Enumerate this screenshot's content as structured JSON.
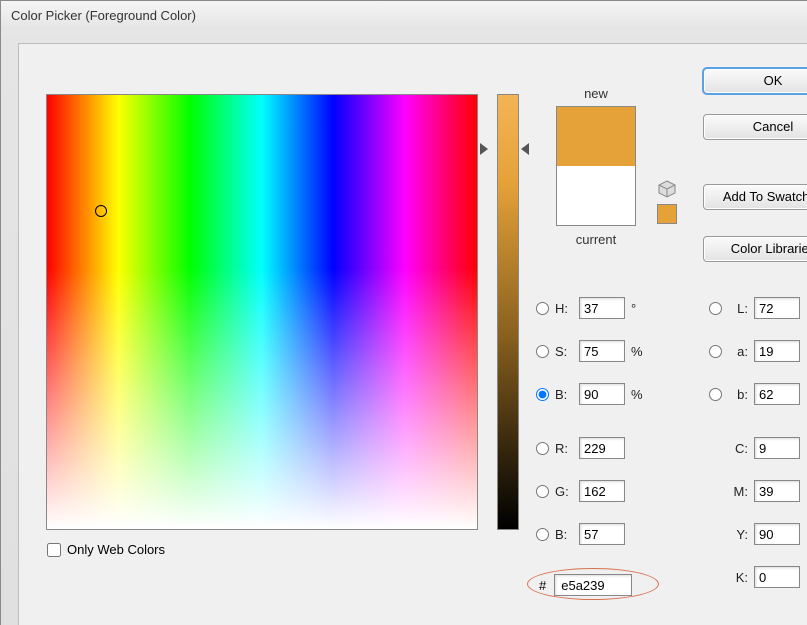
{
  "window": {
    "title": "Color Picker (Foreground Color)"
  },
  "buttons": {
    "ok": "OK",
    "cancel": "Cancel",
    "add_to_swatches": "Add To Swatches",
    "color_libraries": "Color Libraries"
  },
  "swatch": {
    "new_label": "new",
    "current_label": "current",
    "new_color": "#e5a239",
    "current_color": "#ffffff"
  },
  "hsb": {
    "h_label": "H:",
    "h_value": "37",
    "h_unit": "°",
    "s_label": "S:",
    "s_value": "75",
    "s_unit": "%",
    "b_label": "B:",
    "b_value": "90",
    "b_unit": "%",
    "selected": "B"
  },
  "rgb": {
    "r_label": "R:",
    "r_value": "229",
    "g_label": "G:",
    "g_value": "162",
    "b_label": "B:",
    "b_value": "57"
  },
  "lab": {
    "l_label": "L:",
    "l_value": "72",
    "a_label": "a:",
    "a_value": "19",
    "b_label": "b:",
    "b_value": "62"
  },
  "cmyk": {
    "c_label": "C:",
    "c_value": "9",
    "m_label": "M:",
    "m_value": "39",
    "y_label": "Y:",
    "y_value": "90",
    "k_label": "K:",
    "k_value": "0"
  },
  "hex": {
    "prefix": "#",
    "value": "e5a239"
  },
  "only_web_colors": "Only Web Colors"
}
